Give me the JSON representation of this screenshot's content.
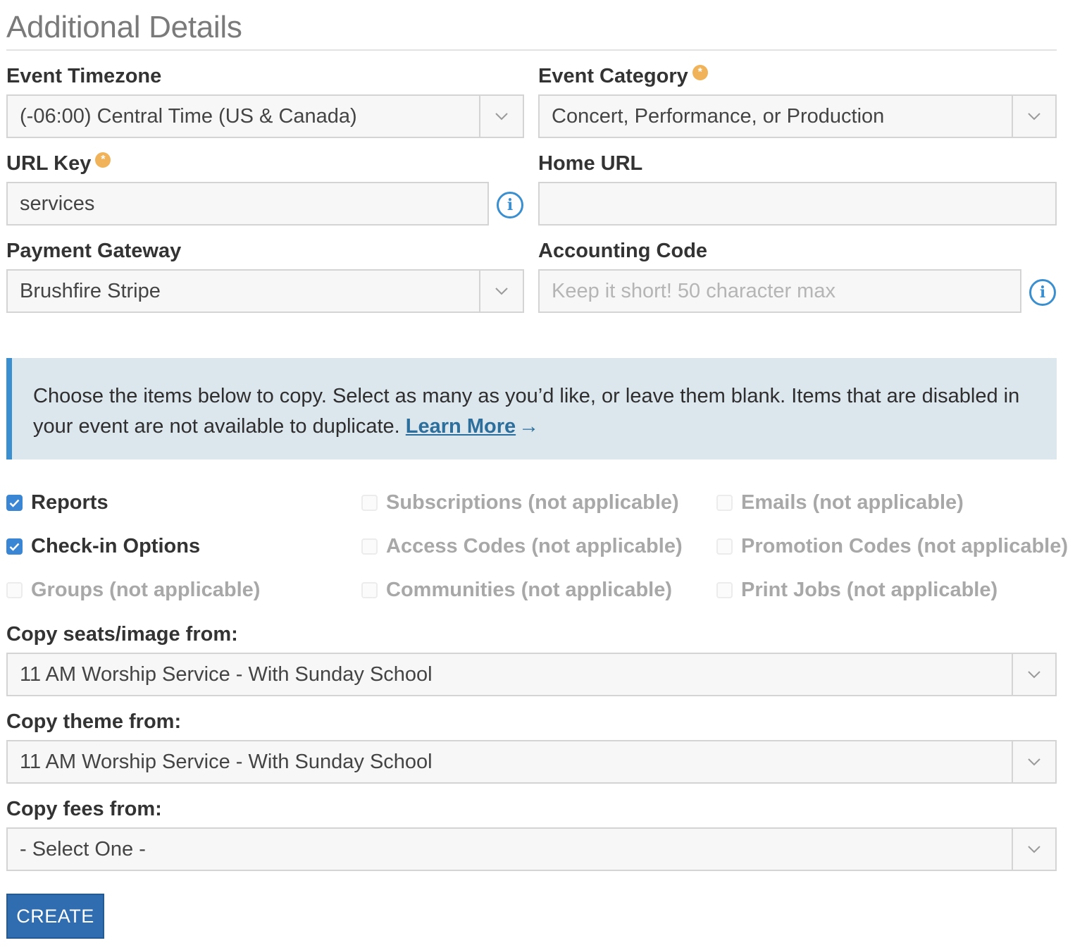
{
  "section": {
    "title": "Additional Details"
  },
  "fields": {
    "event_timezone": {
      "label": "Event Timezone",
      "value": "(-06:00) Central Time (US & Canada)"
    },
    "event_category": {
      "label": "Event Category",
      "value": "Concert, Performance, or Production",
      "required_icon": "asterisk-icon"
    },
    "url_key": {
      "label": "URL Key",
      "value": "services",
      "required_icon": "asterisk-icon"
    },
    "home_url": {
      "label": "Home URL",
      "value": ""
    },
    "payment_gateway": {
      "label": "Payment Gateway",
      "value": "Brushfire Stripe"
    },
    "accounting_code": {
      "label": "Accounting Code",
      "value": "",
      "placeholder": "Keep it short! 50 character max"
    }
  },
  "info_icon_glyph": "i",
  "required_glyph": "*",
  "callout": {
    "text": "Choose the items below to copy. Select as many as you’d like, or leave them blank. Items that are disabled in your event are not available to duplicate.",
    "link_label": "Learn More",
    "link_arrow": "→"
  },
  "copy_options": [
    {
      "label": "Reports",
      "checked": true,
      "enabled": true
    },
    {
      "label": "Subscriptions (not applicable)",
      "checked": false,
      "enabled": false
    },
    {
      "label": "Emails (not applicable)",
      "checked": false,
      "enabled": false
    },
    {
      "label": "Check-in Options",
      "checked": true,
      "enabled": true
    },
    {
      "label": "Access Codes (not applicable)",
      "checked": false,
      "enabled": false
    },
    {
      "label": "Promotion Codes (not applicable)",
      "checked": false,
      "enabled": false
    },
    {
      "label": "Groups (not applicable)",
      "checked": false,
      "enabled": false
    },
    {
      "label": "Communities (not applicable)",
      "checked": false,
      "enabled": false
    },
    {
      "label": "Print Jobs (not applicable)",
      "checked": false,
      "enabled": false
    }
  ],
  "copy_from": {
    "seats": {
      "label": "Copy seats/image from:",
      "value": "11 AM Worship Service - With Sunday School"
    },
    "theme": {
      "label": "Copy theme from:",
      "value": "11 AM Worship Service - With Sunday School"
    },
    "fees": {
      "label": "Copy fees from:",
      "value": "- Select One -"
    }
  },
  "actions": {
    "create_label": "CREATE"
  },
  "colors": {
    "accent": "#3a8fd0",
    "required": "#f0b35a",
    "button": "#2f6cb0",
    "callout_bg": "#dce6ed"
  }
}
